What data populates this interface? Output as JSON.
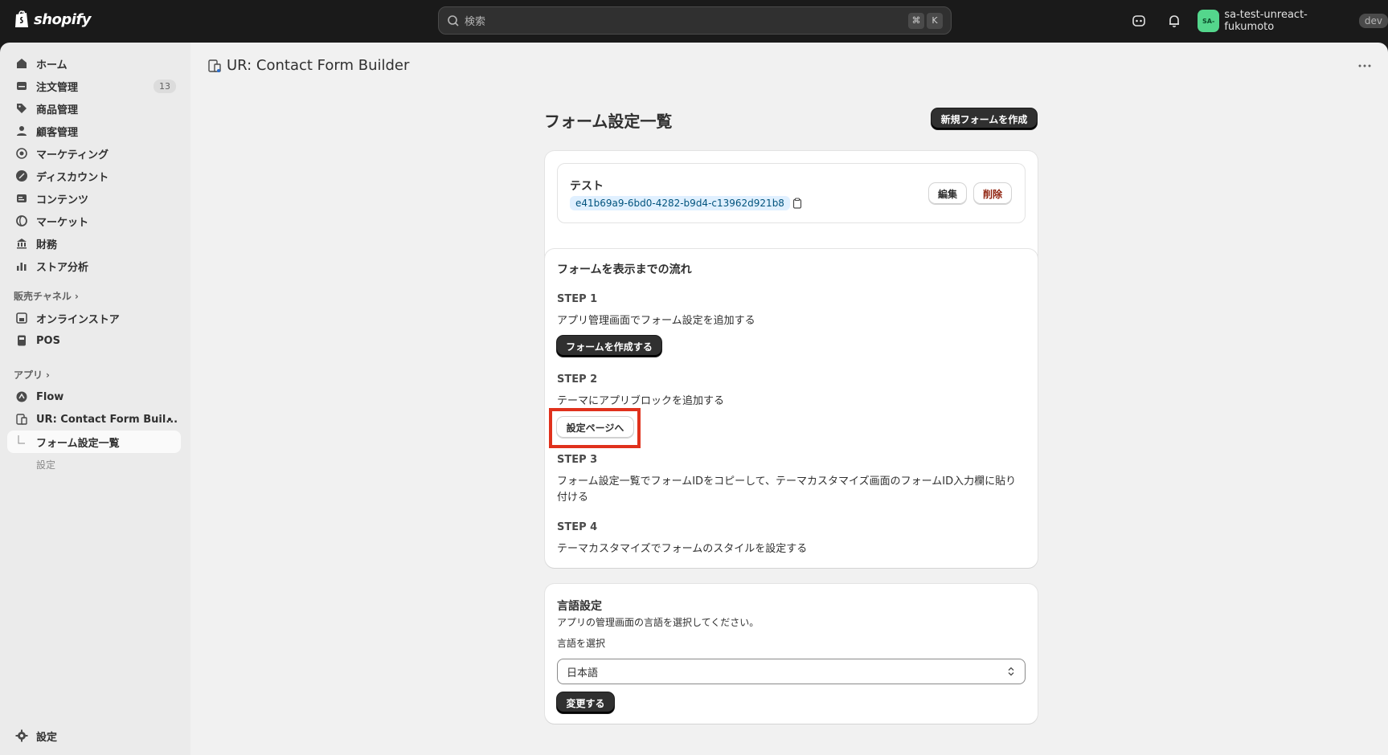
{
  "topbar": {
    "logo_text": "shopify",
    "search_placeholder": "検索",
    "shortcut_keys": [
      "⌘",
      "K"
    ],
    "store_avatar": "SA-",
    "store_name": "sa-test-unreact-fukumoto",
    "store_badge": "dev"
  },
  "sidebar": {
    "items": [
      {
        "label": "ホーム",
        "icon": "home-icon"
      },
      {
        "label": "注文管理",
        "icon": "orders-icon",
        "badge": "13"
      },
      {
        "label": "商品管理",
        "icon": "tag-icon"
      },
      {
        "label": "顧客管理",
        "icon": "person-icon"
      },
      {
        "label": "マーケティング",
        "icon": "target-icon"
      },
      {
        "label": "ディスカウント",
        "icon": "discount-icon"
      },
      {
        "label": "コンテンツ",
        "icon": "content-icon"
      },
      {
        "label": "マーケット",
        "icon": "globe-icon"
      },
      {
        "label": "財務",
        "icon": "bank-icon"
      },
      {
        "label": "ストア分析",
        "icon": "chart-icon"
      }
    ],
    "sales_channels_label": "販売チャネル",
    "channels": [
      {
        "label": "オンラインストア",
        "icon": "store-icon"
      },
      {
        "label": "POS",
        "icon": "pos-icon"
      }
    ],
    "apps_label": "アプリ",
    "apps": [
      {
        "label": "Flow",
        "icon": "flow-icon"
      },
      {
        "label": "UR: Contact Form Buil...",
        "icon": "app-icon"
      }
    ],
    "app_sub_items": [
      "フォーム設定一覧",
      "設定"
    ],
    "settings_label": "設定"
  },
  "main": {
    "app_title": "UR: Contact Form Builder",
    "page_title": "フォーム設定一覧",
    "new_form_button": "新規フォームを作成",
    "form": {
      "name": "テスト",
      "id": "e41b69a9-6bd0-4282-b9d4-c13962d921b8",
      "edit_button": "編集",
      "delete_button": "削除"
    },
    "flow": {
      "title": "フォームを表示までの流れ",
      "steps": [
        {
          "title": "STEP 1",
          "text": "アプリ管理画面でフォーム設定を追加する",
          "button": "フォームを作成する"
        },
        {
          "title": "STEP 2",
          "text": "テーマにアプリブロックを追加する",
          "button": "設定ページへ"
        },
        {
          "title": "STEP 3",
          "text": "フォーム設定一覧でフォームIDをコピーして、テーマカスタマイズ画面のフォームID入力欄に貼り付ける"
        },
        {
          "title": "STEP 4",
          "text": "テーマカスタマイズでフォームのスタイルを設定する"
        }
      ]
    },
    "language": {
      "title": "言語設定",
      "description": "アプリの管理画面の言語を選択してください。",
      "select_label": "言語を選択",
      "selected": "日本語",
      "submit_button": "変更する"
    }
  },
  "colors": {
    "highlight": "#e0311c",
    "badge_bg": "#e0f0ff",
    "avatar": "#54d68c"
  }
}
